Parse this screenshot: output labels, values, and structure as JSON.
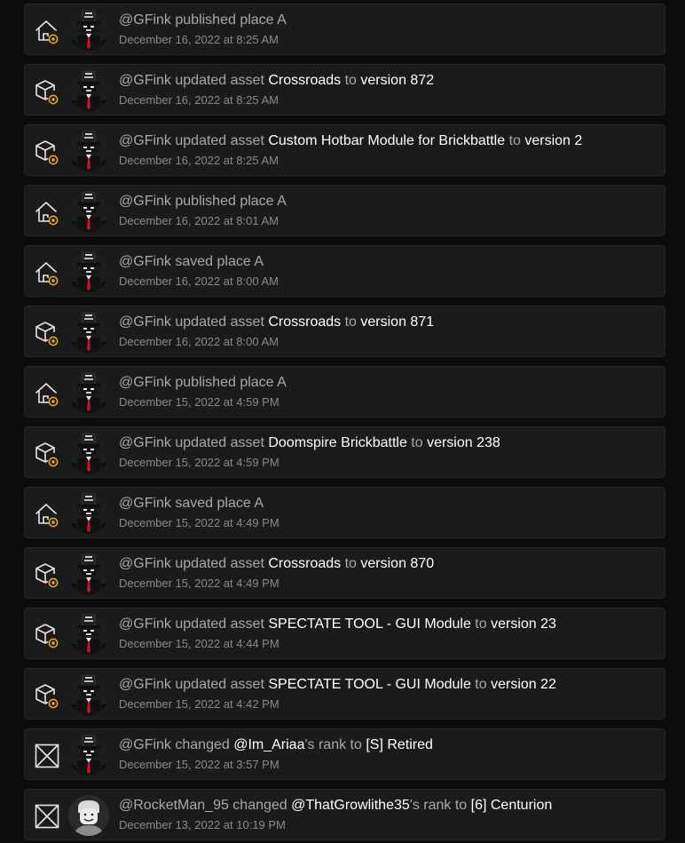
{
  "colors": {
    "background": "#0b0b0b",
    "card": "#1b1b1c",
    "badge": "#f5a623",
    "highlight": "#ffffff",
    "muted": "#a9a9ab"
  },
  "items": [
    {
      "icon": "place-icon",
      "avatar": "gfink",
      "segments": [
        {
          "t": "@GFink",
          "hl": false
        },
        {
          "t": " published place A",
          "hl": false
        }
      ],
      "time": "December 16, 2022 at 8:25 AM"
    },
    {
      "icon": "asset-icon",
      "avatar": "gfink",
      "segments": [
        {
          "t": "@GFink",
          "hl": false
        },
        {
          "t": " updated asset ",
          "hl": false
        },
        {
          "t": "Crossroads",
          "hl": true
        },
        {
          "t": " to ",
          "hl": false
        },
        {
          "t": "version 872",
          "hl": true
        }
      ],
      "time": "December 16, 2022 at 8:25 AM"
    },
    {
      "icon": "asset-icon",
      "avatar": "gfink",
      "segments": [
        {
          "t": "@GFink",
          "hl": false
        },
        {
          "t": " updated asset ",
          "hl": false
        },
        {
          "t": "Custom Hotbar Module for Brickbattle",
          "hl": true
        },
        {
          "t": " to ",
          "hl": false
        },
        {
          "t": "version 2",
          "hl": true
        }
      ],
      "time": "December 16, 2022 at 8:25 AM"
    },
    {
      "icon": "place-icon",
      "avatar": "gfink",
      "segments": [
        {
          "t": "@GFink",
          "hl": false
        },
        {
          "t": " published place A",
          "hl": false
        }
      ],
      "time": "December 16, 2022 at 8:01 AM"
    },
    {
      "icon": "place-icon",
      "avatar": "gfink",
      "segments": [
        {
          "t": "@GFink",
          "hl": false
        },
        {
          "t": " saved place A",
          "hl": false
        }
      ],
      "time": "December 16, 2022 at 8:00 AM"
    },
    {
      "icon": "asset-icon",
      "avatar": "gfink",
      "segments": [
        {
          "t": "@GFink",
          "hl": false
        },
        {
          "t": " updated asset ",
          "hl": false
        },
        {
          "t": "Crossroads",
          "hl": true
        },
        {
          "t": " to ",
          "hl": false
        },
        {
          "t": "version 871",
          "hl": true
        }
      ],
      "time": "December 16, 2022 at 8:00 AM"
    },
    {
      "icon": "place-icon",
      "avatar": "gfink",
      "segments": [
        {
          "t": "@GFink",
          "hl": false
        },
        {
          "t": " published place A",
          "hl": false
        }
      ],
      "time": "December 15, 2022 at 4:59 PM"
    },
    {
      "icon": "asset-icon",
      "avatar": "gfink",
      "segments": [
        {
          "t": "@GFink",
          "hl": false
        },
        {
          "t": " updated asset ",
          "hl": false
        },
        {
          "t": "Doomspire Brickbattle",
          "hl": true
        },
        {
          "t": " to ",
          "hl": false
        },
        {
          "t": "version 238",
          "hl": true
        }
      ],
      "time": "December 15, 2022 at 4:59 PM"
    },
    {
      "icon": "place-icon",
      "avatar": "gfink",
      "segments": [
        {
          "t": "@GFink",
          "hl": false
        },
        {
          "t": " saved place A",
          "hl": false
        }
      ],
      "time": "December 15, 2022 at 4:49 PM"
    },
    {
      "icon": "asset-icon",
      "avatar": "gfink",
      "segments": [
        {
          "t": "@GFink",
          "hl": false
        },
        {
          "t": " updated asset ",
          "hl": false
        },
        {
          "t": "Crossroads",
          "hl": true
        },
        {
          "t": " to ",
          "hl": false
        },
        {
          "t": "version 870",
          "hl": true
        }
      ],
      "time": "December 15, 2022 at 4:49 PM"
    },
    {
      "icon": "asset-icon",
      "avatar": "gfink",
      "segments": [
        {
          "t": "@GFink",
          "hl": false
        },
        {
          "t": " updated asset ",
          "hl": false
        },
        {
          "t": "SPECTATE TOOL - GUI Module",
          "hl": true
        },
        {
          "t": " to ",
          "hl": false
        },
        {
          "t": "version 23",
          "hl": true
        }
      ],
      "time": "December 15, 2022 at 4:44 PM"
    },
    {
      "icon": "asset-icon",
      "avatar": "gfink",
      "segments": [
        {
          "t": "@GFink",
          "hl": false
        },
        {
          "t": " updated asset ",
          "hl": false
        },
        {
          "t": "SPECTATE TOOL - GUI Module",
          "hl": true
        },
        {
          "t": " to ",
          "hl": false
        },
        {
          "t": "version 22",
          "hl": true
        }
      ],
      "time": "December 15, 2022 at 4:42 PM"
    },
    {
      "icon": "rank-icon",
      "avatar": "gfink",
      "segments": [
        {
          "t": "@GFink",
          "hl": false
        },
        {
          "t": " changed ",
          "hl": false
        },
        {
          "t": "@Im_Ariaa",
          "hl": true
        },
        {
          "t": "'s rank to ",
          "hl": false
        },
        {
          "t": "[S] Retired",
          "hl": true
        }
      ],
      "time": "December 15, 2022 at 3:57 PM"
    },
    {
      "icon": "rank-icon",
      "avatar": "rocketman",
      "segments": [
        {
          "t": "@RocketMan_95",
          "hl": false
        },
        {
          "t": " changed ",
          "hl": false
        },
        {
          "t": "@ThatGrowlithe35",
          "hl": true
        },
        {
          "t": "'s rank to ",
          "hl": false
        },
        {
          "t": "[6] Centurion",
          "hl": true
        }
      ],
      "time": "December 13, 2022 at 10:19 PM"
    }
  ]
}
